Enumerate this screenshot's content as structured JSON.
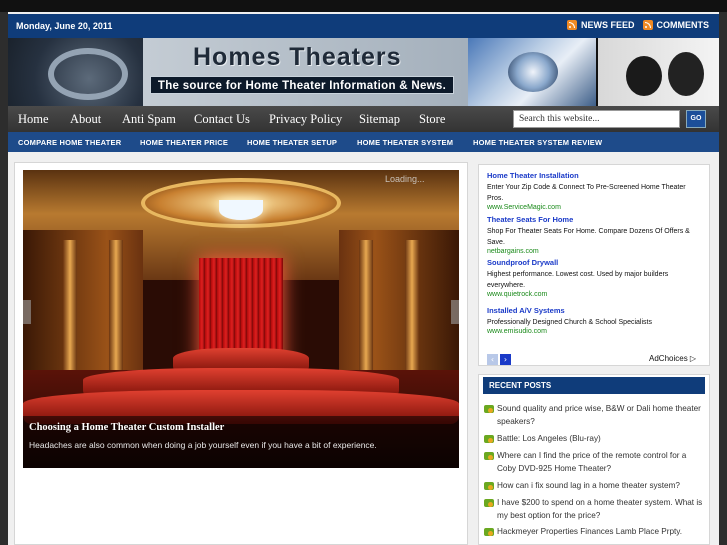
{
  "topbar": {
    "date": "Monday, June 20, 2011",
    "news_feed": "NEWS FEED",
    "comments": "COMMENTS"
  },
  "header": {
    "title": "Homes Theaters",
    "tagline": "The source for Home Theater Information & News."
  },
  "nav": {
    "items": [
      "Home",
      "About",
      "Anti Spam",
      "Contact Us",
      "Privacy Policy",
      "Sitemap",
      "Store"
    ],
    "search_value": "Search this website...",
    "go_label": "GO"
  },
  "subnav": {
    "items": [
      "COMPARE HOME THEATER",
      "HOME THEATER PRICE",
      "HOME THEATER SETUP",
      "HOME THEATER SYSTEM",
      "HOME THEATER SYSTEM REVIEW"
    ]
  },
  "slider": {
    "loading": "Loading...",
    "caption_title": "Choosing a Home Theater Custom Installer",
    "caption_text": "Headaches are also common when doing a job yourself even if you have a bit of experience."
  },
  "ads": {
    "items": [
      {
        "title": "Home Theater Installation",
        "desc": "Enter Your Zip Code & Connect To Pre-Screened Home Theater Pros.",
        "url": "www.ServiceMagic.com"
      },
      {
        "title": "Theater Seats For Home",
        "desc": "Shop For Theater Seats For Home. Compare Dozens Of Offers & Save.",
        "url": "netbargains.com"
      },
      {
        "title": "Soundproof Drywall",
        "desc": "Highest performance. Lowest cost. Used by major builders everywhere.",
        "url": "www.quietrock.com"
      },
      {
        "title": "Installed A/V Systems",
        "desc": "Professionally Designed Church & School Specialists",
        "url": "www.emisudio.com"
      }
    ],
    "prev_icon": "‹",
    "next_icon": "›",
    "adchoices": "AdChoices ▷"
  },
  "recent_posts": {
    "heading": "RECENT POSTS",
    "items": [
      "Sound quality and price wise, B&W or Dali home theater speakers?",
      "Battle: Los Angeles (Blu-ray)",
      "Where can I find the price of the remote control for a Coby DVD-925 Home Theater?",
      "How can i fix sound lag in a home theater system?",
      "I have $200 to spend on a home theater system. What is my best option for the price?",
      "Hackmeyer Properties Finances Lamb Place Prpty."
    ]
  },
  "colors": {
    "primary_blue": "#0f3c7a",
    "nav_dark": "#333333",
    "rss_orange": "#f08a24",
    "ad_link": "#1a3ac8",
    "ad_url": "#1a8a1a"
  },
  "icons": {
    "rss": "rss-icon",
    "post": "post-icon"
  }
}
